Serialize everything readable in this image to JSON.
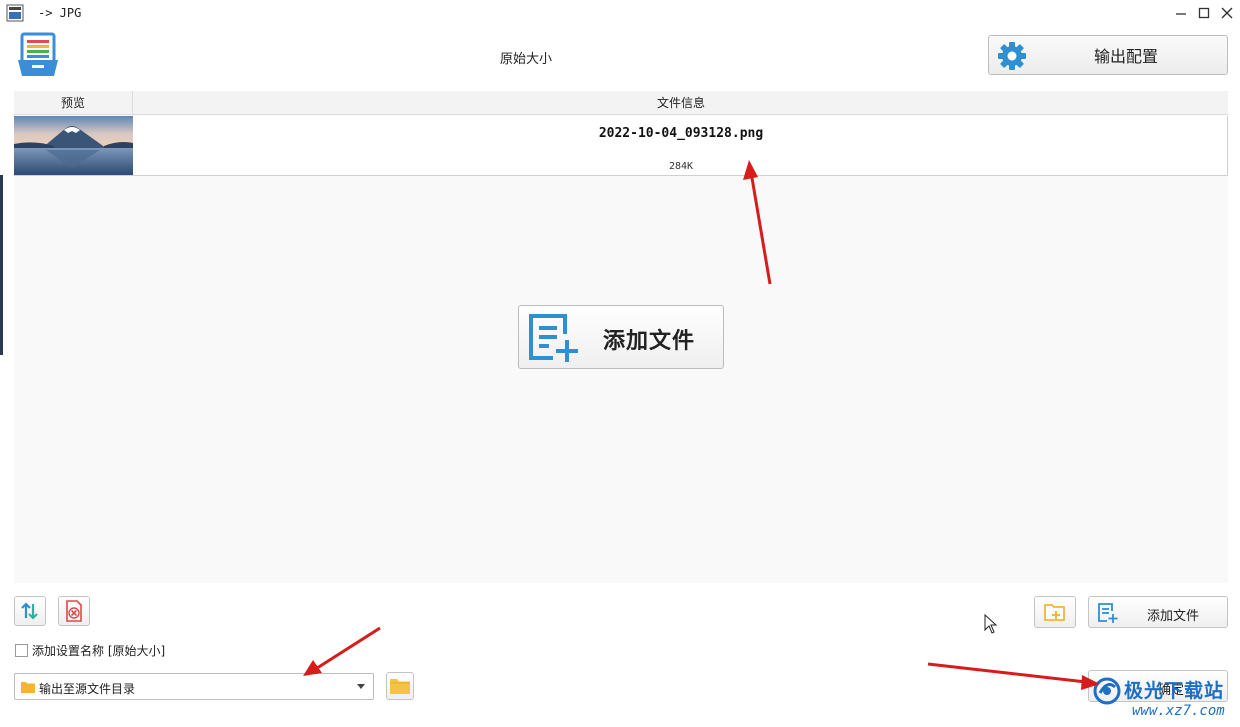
{
  "window": {
    "title": "-> JPG",
    "controls": [
      "minimize",
      "maximize",
      "close"
    ]
  },
  "header": {
    "size_label": "原始大小",
    "output_config_label": "输出配置"
  },
  "table": {
    "columns": [
      "预览",
      "文件信息"
    ],
    "rows": [
      {
        "name": "2022-10-04_093128.png",
        "size": "284K"
      }
    ]
  },
  "main": {
    "add_file_big_label": "添加文件"
  },
  "toolbar": {
    "add_file_label": "添加文件",
    "confirm_label": "确定"
  },
  "options": {
    "add_setting_name_label": "添加设置名称 [原始大小]",
    "add_setting_name_checked": false,
    "output_dir_value": "输出至源文件目录"
  },
  "watermark": {
    "name": "极光下载站",
    "url": "www.xz7.com"
  },
  "colors": {
    "accent_blue": "#2e90d1",
    "annotation_red": "#d81c1c",
    "folder_yellow": "#f2b632",
    "delete_red": "#e04848"
  },
  "icons": [
    "app-icon",
    "logo-icon",
    "gear-icon",
    "add-file-icon",
    "sort-icon",
    "delete-icon",
    "folder-add-icon",
    "folder-icon",
    "chevron-down-icon",
    "watermark-logo"
  ]
}
